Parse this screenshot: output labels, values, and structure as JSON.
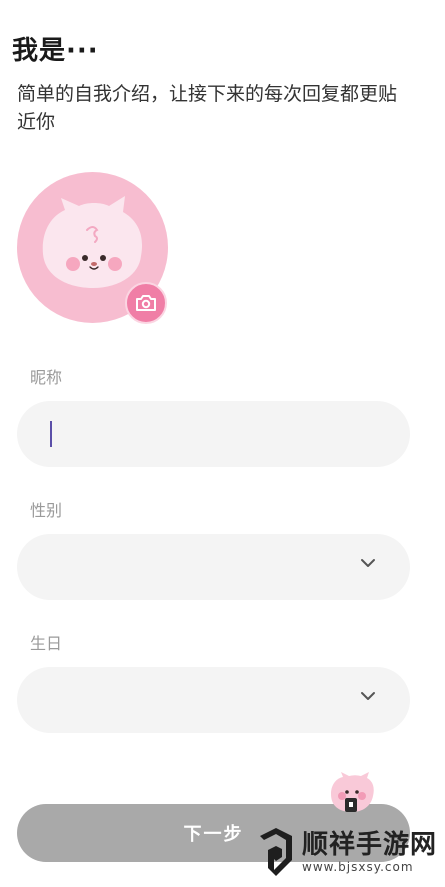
{
  "header": {
    "title": "我是···",
    "subtitle": "简单的自我介绍，让接下来的每次回复都更贴近你"
  },
  "avatar": {
    "icon": "cat-avatar",
    "camera_icon": "camera-icon",
    "bg_color": "#f7bdd0",
    "accent_color": "#f07ea6"
  },
  "form": {
    "nickname": {
      "label": "昵称",
      "value": ""
    },
    "gender": {
      "label": "性别",
      "value": ""
    },
    "birthday": {
      "label": "生日",
      "value": ""
    }
  },
  "actions": {
    "next_label": "下一步"
  },
  "watermark": {
    "name": "顺祥手游网",
    "url": "www.bjsxsy.com"
  }
}
